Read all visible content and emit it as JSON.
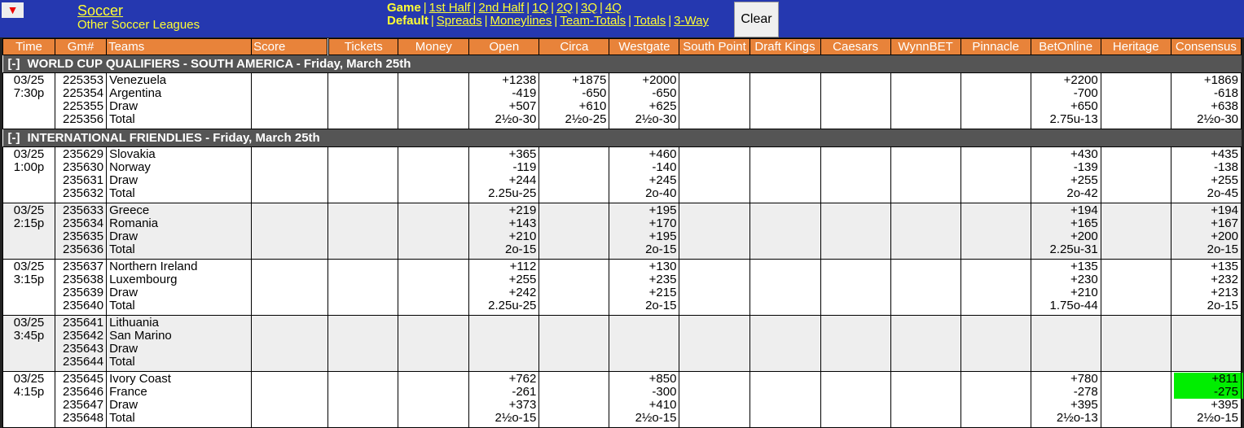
{
  "header": {
    "menu_icon": "red-down-triangle",
    "menu_glyph": "▼",
    "sport": "Soccer",
    "league": "Other Soccer Leagues",
    "period_label": "Game",
    "periods": [
      "1st Half",
      "2nd Half",
      "1Q",
      "2Q",
      "3Q",
      "4Q"
    ],
    "market_label": "Default",
    "markets": [
      "Spreads",
      "Moneylines",
      "Team-Totals",
      "Totals",
      "3-Way"
    ],
    "clear_label": "Clear"
  },
  "columns": [
    "Time",
    "Gm#",
    "Teams",
    "Score",
    "Tickets",
    "Money",
    "Open",
    "Circa",
    "Westgate",
    "South Point",
    "Draft Kings",
    "Caesars",
    "WynnBET",
    "Pinnacle",
    "BetOnline",
    "Heritage",
    "Consensus"
  ],
  "highlight_color": "#00ee00",
  "sections": [
    {
      "toggle": "[-]",
      "title": "WORLD CUP QUALIFIERS - SOUTH AMERICA - Friday, March 25th",
      "games": [
        {
          "date": "03/25",
          "time": "7:30p",
          "gm": [
            "225353",
            "225354",
            "225355",
            "225356"
          ],
          "teams": [
            "Venezuela",
            "Argentina",
            "Draw",
            "Total"
          ],
          "open": [
            "+1238",
            "-419",
            "+507",
            "2½o-30"
          ],
          "circa": [
            "+1875",
            "-650",
            "+610",
            "2½o-25"
          ],
          "westgate": [
            "+2000",
            "-650",
            "+625",
            "2½o-30"
          ],
          "betonline": [
            "+2200",
            "-700",
            "+650",
            "2.75u-13"
          ],
          "consensus": [
            "+1869",
            "-618",
            "+638",
            "2½o-30"
          ]
        }
      ]
    },
    {
      "toggle": "[-]",
      "title": "INTERNATIONAL FRIENDLIES - Friday, March 25th",
      "games": [
        {
          "date": "03/25",
          "time": "1:00p",
          "gm": [
            "235629",
            "235630",
            "235631",
            "235632"
          ],
          "teams": [
            "Slovakia",
            "Norway",
            "Draw",
            "Total"
          ],
          "open": [
            "+365",
            "-119",
            "+244",
            "2.25u-25"
          ],
          "circa": [
            "",
            "",
            "",
            ""
          ],
          "westgate": [
            "+460",
            "-140",
            "+245",
            "2o-40"
          ],
          "betonline": [
            "+430",
            "-139",
            "+255",
            "2o-42"
          ],
          "consensus": [
            "+435",
            "-138",
            "+255",
            "2o-45"
          ]
        },
        {
          "date": "03/25",
          "time": "2:15p",
          "gm": [
            "235633",
            "235634",
            "235635",
            "235636"
          ],
          "teams": [
            "Greece",
            "Romania",
            "Draw",
            "Total"
          ],
          "open": [
            "+219",
            "+143",
            "+210",
            "2o-15"
          ],
          "circa": [
            "",
            "",
            "",
            ""
          ],
          "westgate": [
            "+195",
            "+170",
            "+195",
            "2o-15"
          ],
          "betonline": [
            "+194",
            "+165",
            "+200",
            "2.25u-31"
          ],
          "consensus": [
            "+194",
            "+167",
            "+200",
            "2o-15"
          ]
        },
        {
          "date": "03/25",
          "time": "3:15p",
          "gm": [
            "235637",
            "235638",
            "235639",
            "235640"
          ],
          "teams": [
            "Northern Ireland",
            "Luxembourg",
            "Draw",
            "Total"
          ],
          "open": [
            "+112",
            "+255",
            "+242",
            "2.25u-25"
          ],
          "circa": [
            "",
            "",
            "",
            ""
          ],
          "westgate": [
            "+130",
            "+235",
            "+215",
            "2o-15"
          ],
          "betonline": [
            "+135",
            "+230",
            "+210",
            "1.75o-44"
          ],
          "consensus": [
            "+135",
            "+232",
            "+213",
            "2o-15"
          ]
        },
        {
          "date": "03/25",
          "time": "3:45p",
          "gm": [
            "235641",
            "235642",
            "235643",
            "235644"
          ],
          "teams": [
            "Lithuania",
            "San Marino",
            "Draw",
            "Total"
          ],
          "open": [
            "",
            "",
            "",
            ""
          ],
          "circa": [
            "",
            "",
            "",
            ""
          ],
          "westgate": [
            "",
            "",
            "",
            ""
          ],
          "betonline": [
            "",
            "",
            "",
            ""
          ],
          "consensus": [
            "",
            "",
            "",
            ""
          ]
        },
        {
          "date": "03/25",
          "time": "4:15p",
          "gm": [
            "235645",
            "235646",
            "235647",
            "235648"
          ],
          "teams": [
            "Ivory Coast",
            "France",
            "Draw",
            "Total"
          ],
          "open": [
            "+762",
            "-261",
            "+373",
            "2½o-15"
          ],
          "circa": [
            "",
            "",
            "",
            ""
          ],
          "westgate": [
            "+850",
            "-300",
            "+410",
            "2½o-15"
          ],
          "betonline": [
            "+780",
            "-278",
            "+395",
            "2½o-13"
          ],
          "consensus": [
            "+811",
            "-275",
            "+395",
            "2½o-15"
          ],
          "consensus_highlight": [
            true,
            true,
            false,
            false
          ]
        }
      ]
    }
  ]
}
